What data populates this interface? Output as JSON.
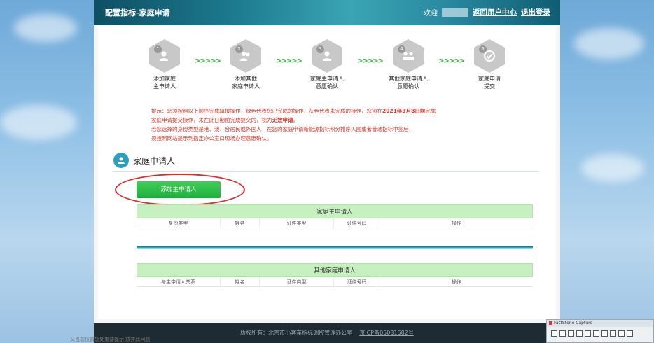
{
  "header": {
    "title": "配置指标-家庭申请",
    "welcome": "欢迎",
    "return_link": "返回用户中心",
    "logout_link": "退出登录"
  },
  "steps": [
    {
      "num": "1",
      "icon": "person-plus-icon",
      "label": "添加家庭\n主申请人"
    },
    {
      "num": "2",
      "icon": "group-plus-icon",
      "label": "添加其他\n家庭申请人"
    },
    {
      "num": "3",
      "icon": "person-confirm-icon",
      "label": "家庭主申请人\n意愿确认"
    },
    {
      "num": "4",
      "icon": "group-confirm-icon",
      "label": "其他家庭申请人\n意愿确认"
    },
    {
      "num": "5",
      "icon": "check-icon",
      "label": "家庭申请\n提交"
    }
  ],
  "arrows": ">>>>>",
  "notice": {
    "line1_prefix": "提示：您须按照以上顺序完成填报操作，绿色代表您已完成的操作，灰色代表未完成的操作，您须在",
    "line1_date": "2021年3月8日前",
    "line1_suffix": "完成",
    "line2_prefix": "家庭申请提交操作，未在此日期前完成提交的，视为",
    "line2_bold": "无效申请",
    "line2_suffix": "。",
    "line3": "若您选择的身份类型是港、澳、台居民或外国人，在您的家庭申请新能源指标积分排序入围或者普通指标中签后，",
    "line4": "须按照网站提示到指定办公室口现场办理意愿确认。"
  },
  "section": {
    "title": "家庭申请人"
  },
  "add_button": "添加主申请人",
  "main_table": {
    "title": "家庭主申请人",
    "columns": [
      "身份类型",
      "姓名",
      "证件类型",
      "证件号码",
      "操作"
    ]
  },
  "other_table": {
    "title": "其他家庭申请人",
    "columns": [
      "与主申请人关系",
      "姓名",
      "证件类型",
      "证件号码",
      "操作"
    ]
  },
  "footer": {
    "copyright": "版权所有：北京市小客车指标调控管理办公室",
    "icp": "京ICP备05031682号"
  },
  "capture": {
    "title": "FastStone Capture"
  },
  "taskbar": {
    "text": "又当前位置您处重要提示   放弃此问题"
  },
  "colors": {
    "header": "#1d7a8f",
    "accent_green": "#1fae3c",
    "notice_red": "#d9372b",
    "table_title_bg": "#c6f0c0"
  }
}
